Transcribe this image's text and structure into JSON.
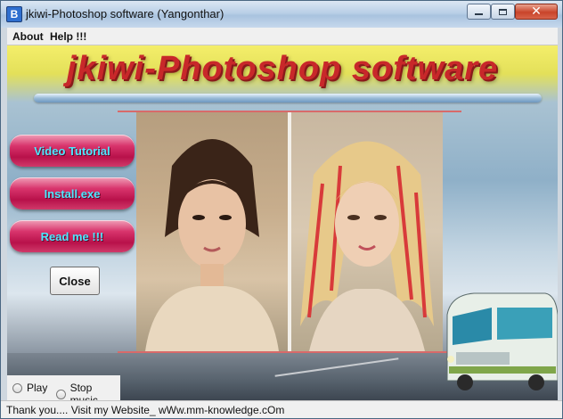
{
  "window": {
    "title": "jkiwi-Photoshop software (Yangonthar)"
  },
  "menu": {
    "items": [
      "About",
      "Help !!!"
    ]
  },
  "banner": {
    "title": "jkiwi-Photoshop software"
  },
  "buttons": {
    "video_tutorial": "Video Tutorial",
    "install": "Install.exe",
    "read_me": "Read me !!!",
    "close": "Close"
  },
  "music": {
    "play_label": "Play",
    "stop_label": "Stop music"
  },
  "status": {
    "text": "Thank you.... Visit my Website_ wWw.mm-knowledge.cOm"
  },
  "colors": {
    "banner_title": "#c8282a",
    "menu_button": "#c0124c",
    "menu_button_text": "#4ee8ff"
  },
  "icons": {
    "app": "app-icon",
    "minimize": "minimize-icon",
    "maximize": "maximize-icon",
    "close": "close-icon"
  }
}
